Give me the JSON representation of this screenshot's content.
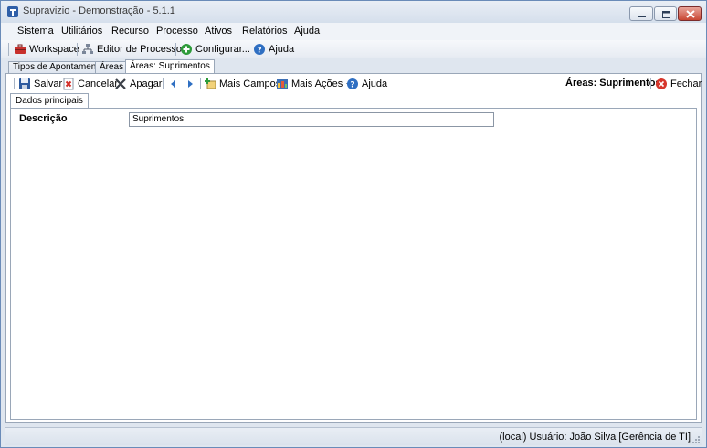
{
  "window": {
    "title": "Supravizio - Demonstração - 5.1.1"
  },
  "menu": {
    "items": [
      "Sistema",
      "Utilitários",
      "Recurso",
      "Processo",
      "Ativos",
      "Relatórios",
      "Ajuda"
    ]
  },
  "toolbar": {
    "workspace": "Workspace",
    "process_editor": "Editor de Processos",
    "configure": "Configurar...",
    "help": "Ajuda"
  },
  "doc_tabs": [
    "Tipos de Apontamento",
    "Áreas",
    "Áreas: Suprimentos"
  ],
  "panel_toolbar": {
    "save": "Salvar",
    "cancel": "Cancelar",
    "delete": "Apagar",
    "more_fields": "Mais Campos",
    "more_actions": "Mais Ações",
    "help": "Ajuda",
    "record_title": "Áreas: Suprimentos",
    "close": "Fechar"
  },
  "form_tabs": [
    "Dados principais"
  ],
  "form": {
    "description_label": "Descrição",
    "description_value": "Suprimentos"
  },
  "status": {
    "text": "(local)  Usuário: João Silva [Gerência de TI]"
  },
  "colors": {
    "accent": "#3565a8",
    "close_button": "#c94733",
    "border": "#9aa7b8"
  }
}
